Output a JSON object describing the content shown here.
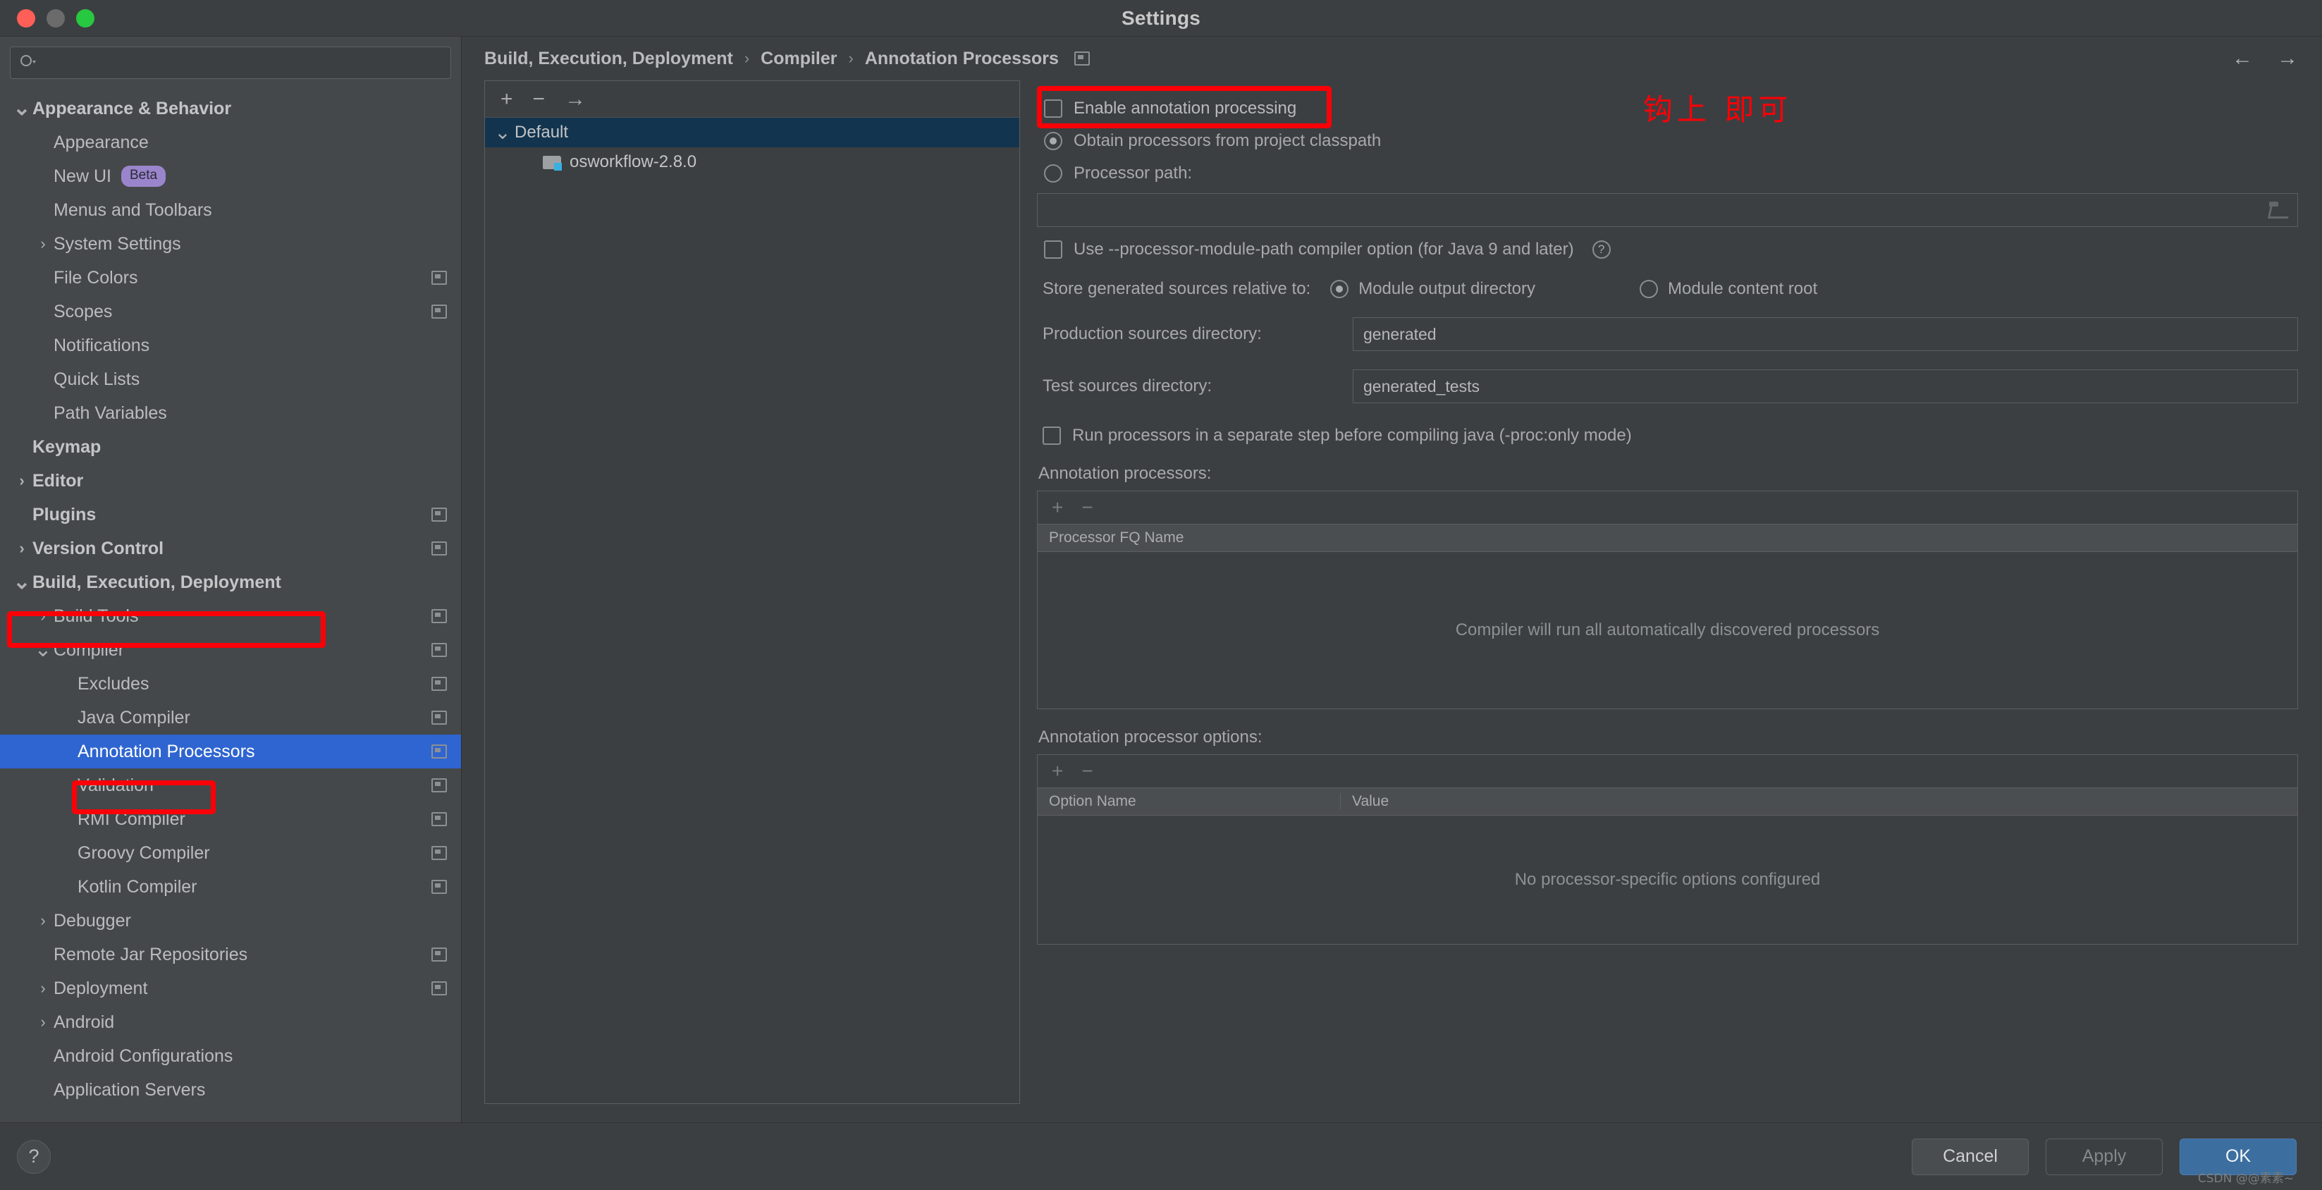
{
  "window": {
    "title": "Settings",
    "traffic_lights": [
      "close",
      "minimize",
      "maximize"
    ]
  },
  "search": {
    "placeholder": "",
    "value": "",
    "icon": "search-icon"
  },
  "sidebar": {
    "items": [
      {
        "label": "Appearance & Behavior",
        "level": 0,
        "chevron": "down",
        "group": true,
        "project_icon": false,
        "selected": false
      },
      {
        "label": "Appearance",
        "level": 1,
        "chevron": "",
        "group": false,
        "project_icon": false,
        "selected": false
      },
      {
        "label": "New UI",
        "level": 1,
        "chevron": "",
        "group": false,
        "project_icon": false,
        "selected": false,
        "badge": "Beta"
      },
      {
        "label": "Menus and Toolbars",
        "level": 1,
        "chevron": "",
        "group": false,
        "project_icon": false,
        "selected": false
      },
      {
        "label": "System Settings",
        "level": 1,
        "chevron": "right",
        "group": false,
        "project_icon": false,
        "selected": false
      },
      {
        "label": "File Colors",
        "level": 1,
        "chevron": "",
        "group": false,
        "project_icon": true,
        "selected": false
      },
      {
        "label": "Scopes",
        "level": 1,
        "chevron": "",
        "group": false,
        "project_icon": true,
        "selected": false
      },
      {
        "label": "Notifications",
        "level": 1,
        "chevron": "",
        "group": false,
        "project_icon": false,
        "selected": false
      },
      {
        "label": "Quick Lists",
        "level": 1,
        "chevron": "",
        "group": false,
        "project_icon": false,
        "selected": false
      },
      {
        "label": "Path Variables",
        "level": 1,
        "chevron": "",
        "group": false,
        "project_icon": false,
        "selected": false
      },
      {
        "label": "Keymap",
        "level": 0,
        "chevron": "",
        "group": true,
        "project_icon": false,
        "selected": false
      },
      {
        "label": "Editor",
        "level": 0,
        "chevron": "right",
        "group": true,
        "project_icon": false,
        "selected": false
      },
      {
        "label": "Plugins",
        "level": 0,
        "chevron": "",
        "group": true,
        "project_icon": true,
        "selected": false
      },
      {
        "label": "Version Control",
        "level": 0,
        "chevron": "right",
        "group": true,
        "project_icon": true,
        "selected": false
      },
      {
        "label": "Build, Execution, Deployment",
        "level": 0,
        "chevron": "down",
        "group": true,
        "project_icon": false,
        "selected": false
      },
      {
        "label": "Build Tools",
        "level": 1,
        "chevron": "right",
        "group": false,
        "project_icon": true,
        "selected": false
      },
      {
        "label": "Compiler",
        "level": 1,
        "chevron": "down",
        "group": false,
        "project_icon": true,
        "selected": false
      },
      {
        "label": "Excludes",
        "level": 2,
        "chevron": "",
        "group": false,
        "project_icon": true,
        "selected": false
      },
      {
        "label": "Java Compiler",
        "level": 2,
        "chevron": "",
        "group": false,
        "project_icon": true,
        "selected": false
      },
      {
        "label": "Annotation Processors",
        "level": 2,
        "chevron": "",
        "group": false,
        "project_icon": true,
        "selected": true
      },
      {
        "label": "Validation",
        "level": 2,
        "chevron": "",
        "group": false,
        "project_icon": true,
        "selected": false
      },
      {
        "label": "RMI Compiler",
        "level": 2,
        "chevron": "",
        "group": false,
        "project_icon": true,
        "selected": false
      },
      {
        "label": "Groovy Compiler",
        "level": 2,
        "chevron": "",
        "group": false,
        "project_icon": true,
        "selected": false
      },
      {
        "label": "Kotlin Compiler",
        "level": 2,
        "chevron": "",
        "group": false,
        "project_icon": true,
        "selected": false
      },
      {
        "label": "Debugger",
        "level": 1,
        "chevron": "right",
        "group": false,
        "project_icon": false,
        "selected": false
      },
      {
        "label": "Remote Jar Repositories",
        "level": 1,
        "chevron": "",
        "group": false,
        "project_icon": true,
        "selected": false
      },
      {
        "label": "Deployment",
        "level": 1,
        "chevron": "right",
        "group": false,
        "project_icon": true,
        "selected": false
      },
      {
        "label": "Android",
        "level": 1,
        "chevron": "right",
        "group": false,
        "project_icon": false,
        "selected": false
      },
      {
        "label": "Android Configurations",
        "level": 1,
        "chevron": "",
        "group": false,
        "project_icon": false,
        "selected": false
      },
      {
        "label": "Application Servers",
        "level": 1,
        "chevron": "",
        "group": false,
        "project_icon": false,
        "selected": false
      }
    ]
  },
  "breadcrumb": {
    "crumbs": [
      "Build, Execution, Deployment",
      "Compiler",
      "Annotation Processors"
    ],
    "separator": "›",
    "project_icon": "project-scope-icon",
    "back_icon": "←",
    "forward_icon": "→"
  },
  "module_pane": {
    "toolbar": {
      "add": "+",
      "remove": "−",
      "move": "→"
    },
    "rows": [
      {
        "label": "Default",
        "chevron": "down",
        "selected": true,
        "child": false
      },
      {
        "label": "osworkflow-2.8.0",
        "chevron": "",
        "selected": false,
        "child": true
      }
    ]
  },
  "settings": {
    "enable_annotation_processing": {
      "label": "Enable annotation processing",
      "checked": false
    },
    "annotation_note_cn": "钩上 即可",
    "source_mode": {
      "options": [
        {
          "label": "Obtain processors from project classpath",
          "selected": true
        },
        {
          "label": "Processor path:",
          "selected": false
        }
      ]
    },
    "processor_path": {
      "value": "",
      "placeholder": "",
      "browse_icon": "folder-open-icon"
    },
    "processor_module_path": {
      "label": "Use --processor-module-path compiler option (for Java 9 and later)",
      "checked": false,
      "help_icon": "?"
    },
    "store_relative": {
      "label": "Store generated sources relative to:",
      "options": [
        {
          "label": "Module output directory",
          "selected": true
        },
        {
          "label": "Module content root",
          "selected": false
        }
      ]
    },
    "production_sources": {
      "label": "Production sources directory:",
      "value": "generated"
    },
    "test_sources": {
      "label": "Test sources directory:",
      "value": "generated_tests"
    },
    "separate_step": {
      "label": "Run processors in a separate step before compiling java (-proc:only mode)",
      "checked": false
    },
    "processors_table": {
      "section_label": "Annotation processors:",
      "toolbar": {
        "add": "+",
        "remove": "−"
      },
      "column": "Processor FQ Name",
      "empty_message": "Compiler will run all automatically discovered processors"
    },
    "options_table": {
      "section_label": "Annotation processor options:",
      "toolbar": {
        "add": "+",
        "remove": "−"
      },
      "columns": [
        "Option Name",
        "Value"
      ],
      "empty_message": "No processor-specific options configured"
    }
  },
  "footer": {
    "help": "?",
    "cancel": "Cancel",
    "apply": "Apply",
    "ok": "OK",
    "watermark": "CSDN @@素素~"
  },
  "colors": {
    "accent_selection": "#2f65d0",
    "annotation_red": "#fb0007",
    "primary_button": "#3c6ea0",
    "module_selection": "#12344f",
    "beta_badge": "#9a85cd"
  }
}
